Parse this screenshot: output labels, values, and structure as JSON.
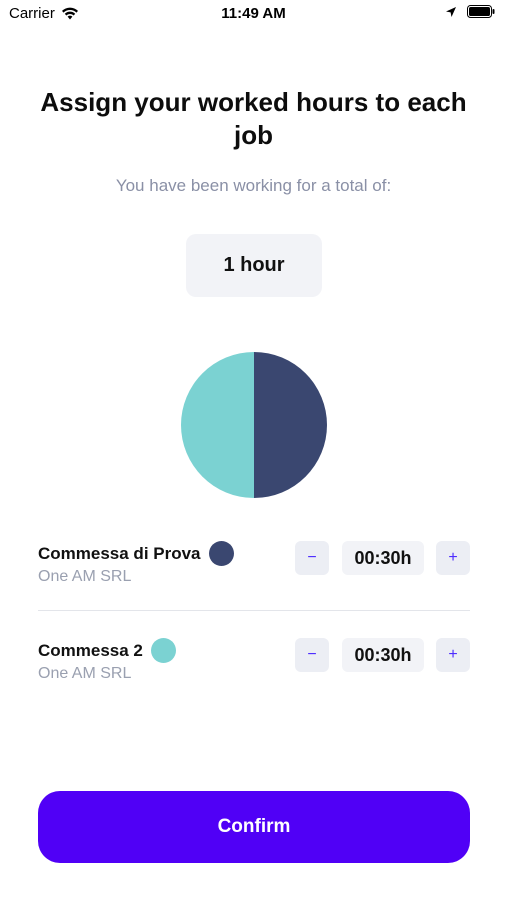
{
  "status_bar": {
    "carrier": "Carrier",
    "time": "11:49 AM",
    "icons": [
      "wifi-icon",
      "location-arrow-icon",
      "battery-icon"
    ]
  },
  "header": {
    "title": "Assign your worked hours to each job",
    "subtitle": "You have been working for a total of:",
    "total": "1 hour"
  },
  "chart_data": {
    "type": "pie",
    "slices": [
      {
        "label": "Commessa di Prova",
        "value": 30,
        "color": "#3a4770"
      },
      {
        "label": "Commessa 2",
        "value": 30,
        "color": "#7bd2d2"
      }
    ]
  },
  "jobs": [
    {
      "name": "Commessa di Prova",
      "company": "One AM SRL",
      "hours": "00:30h",
      "color": "#3a4770",
      "minus_label": "−",
      "plus_label": "+"
    },
    {
      "name": "Commessa 2",
      "company": "One AM SRL",
      "hours": "00:30h",
      "color": "#7bd2d2",
      "minus_label": "−",
      "plus_label": "+"
    }
  ],
  "actions": {
    "confirm_label": "Confirm"
  }
}
